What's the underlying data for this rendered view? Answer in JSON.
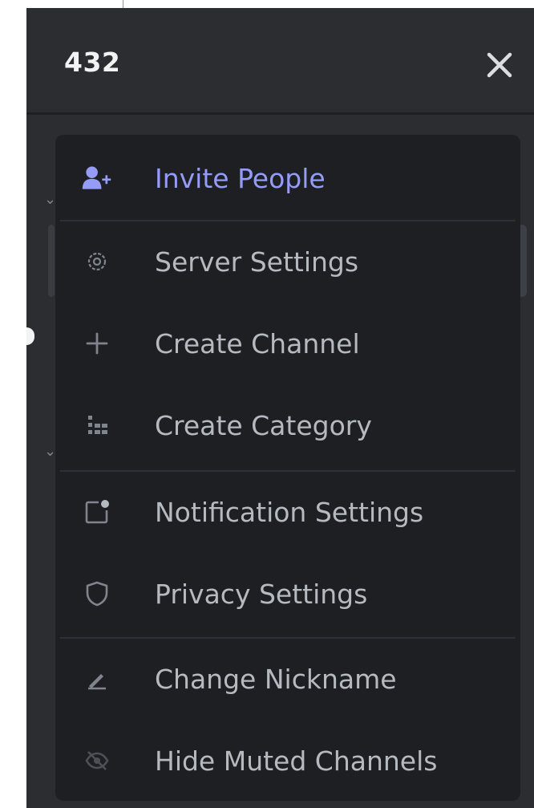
{
  "server": {
    "name": "432"
  },
  "menu": {
    "items": [
      {
        "label": "Invite People",
        "icon": "add-user-icon",
        "accent": "#949cf7"
      },
      {
        "label": "Server Settings",
        "icon": "gear-icon"
      },
      {
        "label": "Create Channel",
        "icon": "plus-icon"
      },
      {
        "label": "Create Category",
        "icon": "folder-tree-icon"
      },
      {
        "label": "Notification Settings",
        "icon": "bell-notification-icon"
      },
      {
        "label": "Privacy Settings",
        "icon": "shield-icon"
      },
      {
        "label": "Change Nickname",
        "icon": "pencil-icon"
      },
      {
        "label": "Hide Muted Channels",
        "icon": "eye-slash-icon"
      }
    ]
  },
  "colors": {
    "background": "#2b2d31",
    "menu_background": "#1e1f22",
    "accent": "#949cf7",
    "text": "#b5bac1",
    "title": "#f2f3f5"
  }
}
